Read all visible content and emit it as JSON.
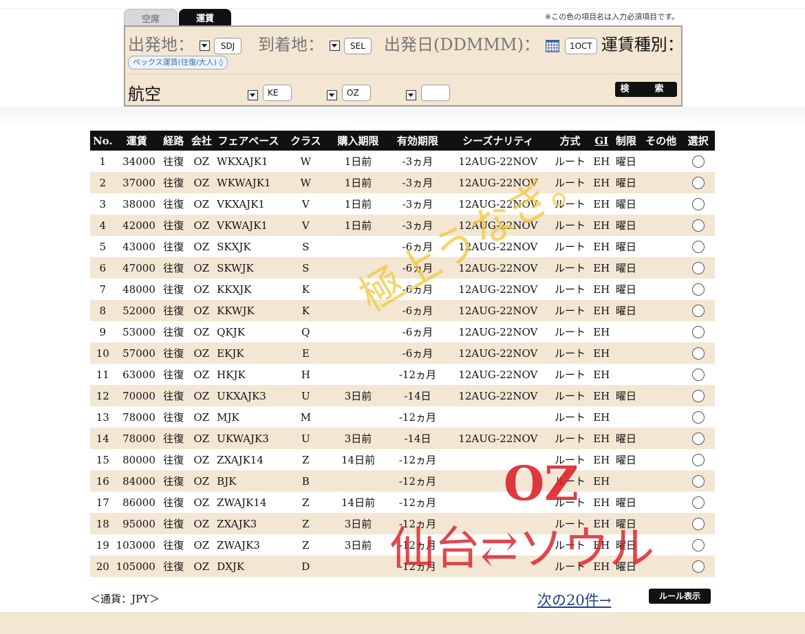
{
  "tabs": [
    {
      "label": "空席",
      "active": false
    },
    {
      "label": "運賃",
      "active": true
    }
  ],
  "required_note": "※この色の項目名は入力必須項目です。",
  "search_panel": {
    "origin_label": "出発地：",
    "origin_value": "SDJ",
    "destination_label": "到着地：",
    "destination_value": "SEL",
    "date_label": "出発日(DDMMM)：",
    "date_value": "1OCT",
    "fare_type_label": "運賃種別：",
    "fare_type_value": "ペックス運賃(往復/大人)",
    "airline_label": "航空会社指定：",
    "airline_1": "KE",
    "airline_2": "OZ",
    "airline_3": "",
    "search_button": "検　索"
  },
  "table": {
    "headers": [
      "No.",
      "運賃",
      "経路",
      "会社",
      "フェアベース",
      "クラス",
      "購入期限",
      "有効期限",
      "シーズナリティ",
      "方式",
      "GI",
      "制限",
      "その他",
      "選択"
    ],
    "rows": [
      [
        "1",
        "34000",
        "往復",
        "OZ",
        "WKXAJK1",
        "W",
        "1日前",
        "-3ヵ月",
        "12AUG-22NOV",
        "ルート",
        "EH",
        "曜日",
        ""
      ],
      [
        "2",
        "37000",
        "往復",
        "OZ",
        "WKWAJK1",
        "W",
        "1日前",
        "-3ヵ月",
        "12AUG-22NOV",
        "ルート",
        "EH",
        "曜日",
        ""
      ],
      [
        "3",
        "38000",
        "往復",
        "OZ",
        "VKXAJK1",
        "V",
        "1日前",
        "-3ヵ月",
        "12AUG-22NOV",
        "ルート",
        "EH",
        "曜日",
        ""
      ],
      [
        "4",
        "42000",
        "往復",
        "OZ",
        "VKWAJK1",
        "V",
        "1日前",
        "-3ヵ月",
        "12AUG-22NOV",
        "ルート",
        "EH",
        "曜日",
        ""
      ],
      [
        "5",
        "43000",
        "往復",
        "OZ",
        "SKXJK",
        "S",
        "",
        "-6ヵ月",
        "12AUG-22NOV",
        "ルート",
        "EH",
        "曜日",
        ""
      ],
      [
        "6",
        "47000",
        "往復",
        "OZ",
        "SKWJK",
        "S",
        "",
        "-6ヵ月",
        "12AUG-22NOV",
        "ルート",
        "EH",
        "曜日",
        ""
      ],
      [
        "7",
        "48000",
        "往復",
        "OZ",
        "KKXJK",
        "K",
        "",
        "-6ヵ月",
        "12AUG-22NOV",
        "ルート",
        "EH",
        "曜日",
        ""
      ],
      [
        "8",
        "52000",
        "往復",
        "OZ",
        "KKWJK",
        "K",
        "",
        "-6ヵ月",
        "12AUG-22NOV",
        "ルート",
        "EH",
        "曜日",
        ""
      ],
      [
        "9",
        "53000",
        "往復",
        "OZ",
        "QKJK",
        "Q",
        "",
        "-6ヵ月",
        "12AUG-22NOV",
        "ルート",
        "EH",
        "",
        ""
      ],
      [
        "10",
        "57000",
        "往復",
        "OZ",
        "EKJK",
        "E",
        "",
        "-6ヵ月",
        "12AUG-22NOV",
        "ルート",
        "EH",
        "",
        ""
      ],
      [
        "11",
        "63000",
        "往復",
        "OZ",
        "HKJK",
        "H",
        "",
        "-12ヵ月",
        "12AUG-22NOV",
        "ルート",
        "EH",
        "",
        ""
      ],
      [
        "12",
        "70000",
        "往復",
        "OZ",
        "UKXAJK3",
        "U",
        "3日前",
        "-14日",
        "12AUG-22NOV",
        "ルート",
        "EH",
        "曜日",
        ""
      ],
      [
        "13",
        "78000",
        "往復",
        "OZ",
        "MJK",
        "M",
        "",
        "-12ヵ月",
        "",
        "ルート",
        "EH",
        "",
        ""
      ],
      [
        "14",
        "78000",
        "往復",
        "OZ",
        "UKWAJK3",
        "U",
        "3日前",
        "-14日",
        "12AUG-22NOV",
        "ルート",
        "EH",
        "曜日",
        ""
      ],
      [
        "15",
        "80000",
        "往復",
        "OZ",
        "ZXAJK14",
        "Z",
        "14日前",
        "-12ヵ月",
        "",
        "ルート",
        "EH",
        "曜日",
        ""
      ],
      [
        "16",
        "84000",
        "往復",
        "OZ",
        "BJK",
        "B",
        "",
        "-12ヵ月",
        "",
        "ルート",
        "EH",
        "",
        ""
      ],
      [
        "17",
        "86000",
        "往復",
        "OZ",
        "ZWAJK14",
        "Z",
        "14日前",
        "-12ヵ月",
        "",
        "ルート",
        "EH",
        "曜日",
        ""
      ],
      [
        "18",
        "95000",
        "往復",
        "OZ",
        "ZXAJK3",
        "Z",
        "3日前",
        "-12ヵ月",
        "",
        "ルート",
        "EH",
        "曜日",
        ""
      ],
      [
        "19",
        "103000",
        "往復",
        "OZ",
        "ZWAJK3",
        "Z",
        "3日前",
        "-12ヵ月",
        "",
        "ルート",
        "EH",
        "曜日",
        ""
      ],
      [
        "20",
        "105000",
        "往復",
        "OZ",
        "DXJK",
        "D",
        "",
        "-12ヵ月",
        "",
        "ルート",
        "EH",
        "曜日",
        ""
      ]
    ]
  },
  "currency_note": "＜通貨：JPY＞",
  "next_link": "次の20件→",
  "rule_button": "ルール表示",
  "overlay": {
    "stamp_text": "極上うなぎ。",
    "airline_code": "OZ",
    "route": "仙台⇄ソウル"
  },
  "colors": {
    "panel_bg": "#f3e6d2",
    "header_bg": "#111111",
    "stripe": "#f3e6d2",
    "link": "#1f3d8a",
    "overlay_red": "#dc1e28",
    "overlay_yellow": "#f0c83c"
  }
}
